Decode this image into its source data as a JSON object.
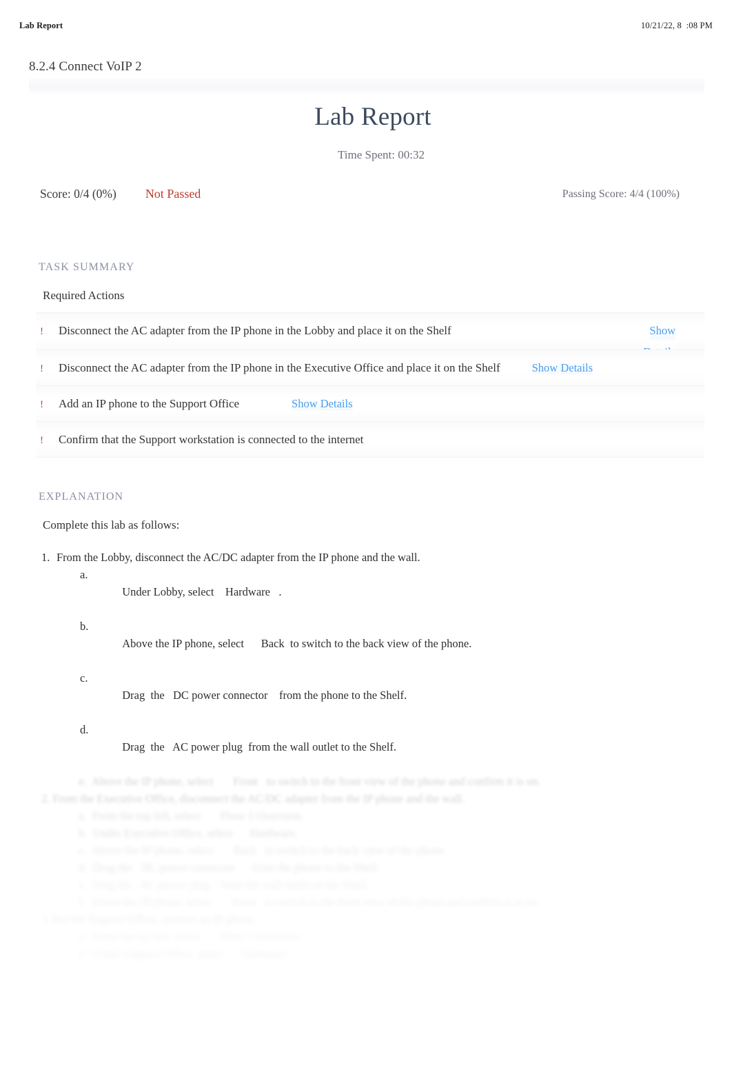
{
  "print_header": {
    "title": "Lab Report",
    "date": "10/21/22, 8  :08 PM"
  },
  "lab": {
    "title": "8.2.4 Connect VoIP 2",
    "report_heading": "Lab Report",
    "time_spent": "Time Spent: 00:32"
  },
  "score": {
    "score_text": "Score: 0/4 (0%)",
    "status": "Not Passed",
    "passing_score": "Passing Score: 4/4 (100%)"
  },
  "task_summary": {
    "section_label": "TASK SUMMARY",
    "subsection_title": "Required Actions",
    "mark": "!",
    "items": [
      {
        "text": "Disconnect the AC adapter from the IP phone in the Lobby and place it on the Shelf",
        "link_part_1": "Show",
        "link_part_2": "Details"
      },
      {
        "text": "Disconnect the AC adapter from the IP phone in the Executive Office and place it on the Shelf",
        "link": "Show Details"
      },
      {
        "text": "Add an IP phone to the Support Office",
        "link": "Show Details"
      },
      {
        "text": "Confirm that the Support workstation is connected to the internet",
        "link": ""
      }
    ]
  },
  "explanation": {
    "section_label": "EXPLANATION",
    "intro": "Complete this lab as follows:",
    "steps": [
      {
        "num": "1.",
        "text": "From the Lobby, disconnect the AC/DC adapter from the IP phone and the wall.",
        "substeps": [
          {
            "let": "a.",
            "text": "Under Lobby, select    Hardware   ."
          },
          {
            "let": "b.",
            "text": "Above the IP phone, select      Back  to switch to the back view of the phone."
          },
          {
            "let": "c.",
            "text": "Drag  the   DC power connector    from the phone to the Shelf."
          },
          {
            "let": "d.",
            "text": "Drag  the   AC power plug  from the wall outlet to the Shelf."
          }
        ]
      }
    ],
    "faded_lines": [
      "e.  Above the IP phone, select       Front   to switch to the front view of the phone and confirm it is on.",
      "2. From the Executive Office, disconnect the AC/DC adapter from the IP phone and the wall.",
      "a.  From the top left, select       Floor 1 Overview.",
      "b.  Under Executive Office, select      Hardware.",
      "c.  Above the IP phone, select       Back   to switch to the back view of the phone.",
      "d.  Drag the   DC power connector      from the phone to the Shelf.",
      "e.  Drag the   AC power plug    from the wall outlet to the Shelf.",
      "f.  Above the IP phone, select       Front   to switch to the front view of the phone and confirm it is on.",
      "3. For the Support Office, connect an IP phone.",
      "a.  From the top left, select       Floor 1 Overview.",
      "b.  Under Support Office, select      Hardware."
    ]
  },
  "colors": {
    "accent_red": "#c0392b",
    "link_blue": "#4a9ef0",
    "heading_navy": "#3c4a5e",
    "muted_gray": "#6e6e7a",
    "section_label": "#8a8fa3"
  }
}
